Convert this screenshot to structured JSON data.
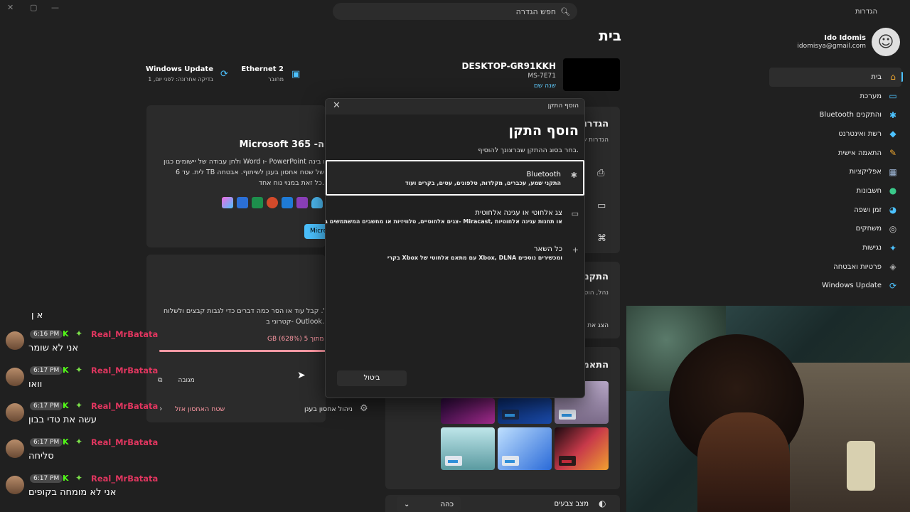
{
  "app": {
    "title": "הגדרות",
    "window_controls": [
      "✕",
      "▢",
      "—"
    ]
  },
  "search": {
    "placeholder": "חפש הגדרה"
  },
  "page": {
    "title": "בית"
  },
  "profile": {
    "name": "Ido Idomis",
    "email": "idomisya@gmail.com"
  },
  "sidebar": {
    "items": [
      {
        "label": "בית",
        "icon": "home-icon",
        "glyph": "⌂",
        "color": "#f0a830"
      },
      {
        "label": "מערכת",
        "icon": "system-icon",
        "glyph": "▭",
        "color": "#4cc2ff"
      },
      {
        "label": "Bluetooth והתקנים",
        "icon": "bluetooth-icon",
        "glyph": "✱",
        "color": "#4cc2ff"
      },
      {
        "label": "רשת ואינטרנט",
        "icon": "network-icon",
        "glyph": "◆",
        "color": "#4cc2ff"
      },
      {
        "label": "התאמה אישית",
        "icon": "brush-icon",
        "glyph": "✎",
        "color": "#f0a830"
      },
      {
        "label": "אפליקציות",
        "icon": "apps-icon",
        "glyph": "▦",
        "color": "#9fb8d8"
      },
      {
        "label": "חשבונות",
        "icon": "account-icon",
        "glyph": "●",
        "color": "#3ac98a"
      },
      {
        "label": "זמן ושפה",
        "icon": "globe-icon",
        "glyph": "◕",
        "color": "#4cc2ff"
      },
      {
        "label": "משחקים",
        "icon": "gamepad-icon",
        "glyph": "◎",
        "color": "#ccc"
      },
      {
        "label": "נגישות",
        "icon": "accessibility-icon",
        "glyph": "✦",
        "color": "#4cc2ff"
      },
      {
        "label": "פרטיות ואבטחה",
        "icon": "shield-icon",
        "glyph": "◈",
        "color": "#aaa"
      },
      {
        "label": "Windows Update",
        "icon": "update-icon",
        "glyph": "⟳",
        "color": "#4cc2ff"
      }
    ]
  },
  "device": {
    "name": "DESKTOP-GR91KKH",
    "model": "MS-7E71",
    "rename": "שנה שם"
  },
  "status": {
    "ethernet": {
      "title": "Ethernet 2",
      "sub": "מחובר"
    },
    "update": {
      "title": "Windows Update",
      "sub": "בדיקה אחרונה: לפני יום, 1"
    }
  },
  "m365": {
    "title": "Microsoft 365 -ה",
    "text1": "ולחן עבודה של יישומים כגון Word ו- PowerPoint עם בינה",
    "text2": "לית. עד 6 TB של שטח אחסון בענן לשיתוף. אבטחה",
    "text3": "כל זאת במנוי נוח אחד.",
    "button": "Micro"
  },
  "onedrive": {
    "text1": "ל. קבל עוד או הסר כמה דברים כדי לגבות קבצים ולשלוח",
    "text2": "קטרוני ב- Outlook.",
    "usage": "GB (628%) 5 מתוך G",
    "backup": "מגובה",
    "manage": "ניהול אחסון בענן",
    "free": "שטח האחסון אזל"
  },
  "right_cards": {
    "recommended": "הגדרו",
    "recommended_sub": "הגדרות ש",
    "devices": "התקנ",
    "devices_sub": "נהל, הוס",
    "devices_row": "הצג את",
    "personalize": "התאמ"
  },
  "colormode": {
    "label": "מצב צבעים",
    "value": "כהה"
  },
  "dialog": {
    "window_title": "הוסף התקן",
    "heading": "הוסף התקן",
    "subtitle": "בחר בסוג ההתקן שברצונך להוסיף.",
    "options": [
      {
        "title": "Bluetooth",
        "desc": "התקני שמע, עכברים, מקלדות, טלפונים, עטים, בקרים ועוד",
        "icon": "bluetooth-icon",
        "glyph": "✱"
      },
      {
        "title": "צג אלחוטי או עגינה אלחוטית",
        "desc": "צגים אלחוטיים, טלוויזיות או מחשבים המשתמשים ב- Miracast, או תחנות עגינה אלחוטיות",
        "icon": "monitor-icon",
        "glyph": "▭"
      },
      {
        "title": "כל השאר",
        "desc": "בקרי Xbox עם מתאם אלחוטי של Xbox, DLNA ומכשירים נוספים",
        "icon": "plus-icon",
        "glyph": "+"
      }
    ],
    "cancel": "ביטול"
  },
  "chat": {
    "partial": "א  ן ",
    "messages": [
      {
        "time": "6:16 PM",
        "user": "Real_MrBatata",
        "text": "אני לא שומר"
      },
      {
        "time": "6:17 PM",
        "user": "Real_MrBatata",
        "text": "וואו"
      },
      {
        "time": "6:17 PM",
        "user": "Real_MrBatata",
        "text": "עשה את טדי בבון"
      },
      {
        "time": "6:17 PM",
        "user": "Real_MrBatata",
        "text": "סליחה"
      },
      {
        "time": "6:17 PM",
        "user": "Real_MrBatata",
        "text": "אני לא מומחה בקופים"
      }
    ]
  }
}
